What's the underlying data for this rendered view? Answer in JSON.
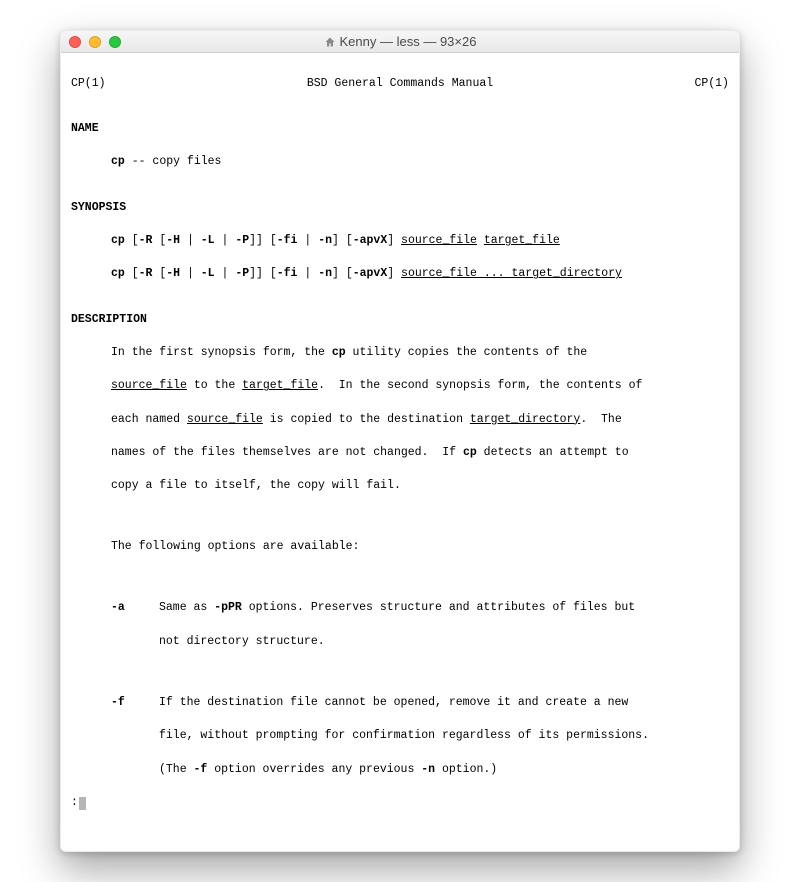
{
  "window": {
    "title": "Kenny — less — 93×26",
    "home_icon": "home-icon"
  },
  "header": {
    "left": "CP(1)",
    "center": "BSD General Commands Manual",
    "right": "CP(1)"
  },
  "sections": {
    "name_label": "NAME",
    "name_cmd": "cp",
    "name_sep": " -- ",
    "name_desc": "copy files",
    "synopsis_label": "SYNOPSIS",
    "syn1": {
      "cmd": "cp",
      "brk1_open": " [",
      "flag_R": "-R",
      "brk2_open": " [",
      "flag_H": "-H",
      "pipe1": " | ",
      "flag_L": "-L",
      "pipe2": " | ",
      "flag_P": "-P",
      "brk2_close": "]",
      "brk1_close": "] ",
      "brk3_open": "[",
      "flag_fi": "-fi",
      "pipe3": " | ",
      "flag_n": "-n",
      "brk3_close": "] ",
      "brk4_open": "[",
      "flag_apvX": "-apvX",
      "brk4_close": "] ",
      "arg1": "source_file",
      "sp": " ",
      "arg2": "target_file"
    },
    "syn2": {
      "cmd": "cp",
      "brk1_open": " [",
      "flag_R": "-R",
      "brk2_open": " [",
      "flag_H": "-H",
      "pipe1": " | ",
      "flag_L": "-L",
      "pipe2": " | ",
      "flag_P": "-P",
      "brk2_close": "]",
      "brk1_close": "] ",
      "brk3_open": "[",
      "flag_fi": "-fi",
      "pipe3": " | ",
      "flag_n": "-n",
      "brk3_close": "] ",
      "brk4_open": "[",
      "flag_apvX": "-apvX",
      "brk4_close": "] ",
      "arg1": "source_file",
      "ell": " ... ",
      "arg2": "target_directory"
    },
    "description_label": "DESCRIPTION",
    "desc": {
      "p1a": "In the first synopsis form, the ",
      "p1_cp": "cp",
      "p1b": " utility copies the contents of the",
      "p2_sf": "source_file",
      "p2a": " to the ",
      "p2_tf": "target_file",
      "p2b": ".  In the second synopsis form, the contents of",
      "p3a": "each named ",
      "p3_sf": "source_file",
      "p3b": " is copied to the destination ",
      "p3_td": "target_directory",
      "p3c": ".  The",
      "p4a": "names of the files themselves are not changed.  If ",
      "p4_cp": "cp",
      "p4b": " detects an attempt to",
      "p5": "copy a file to itself, the copy will fail.",
      "p_opts": "The following options are available:"
    },
    "opt_a": {
      "flag": "-a",
      "d1a": "Same as ",
      "d1_pPR": "-pPR",
      "d1b": " options. Preserves structure and attributes of files but",
      "d2": "not directory structure."
    },
    "opt_f": {
      "flag": "-f",
      "d1": "If the destination file cannot be opened, remove it and create a new",
      "d2": "file, without prompting for confirmation regardless of its permissions.",
      "d3a": "(The ",
      "d3_f": "-f",
      "d3b": " option overrides any previous ",
      "d3_n": "-n",
      "d3c": " option.)"
    }
  },
  "prompt": ":"
}
